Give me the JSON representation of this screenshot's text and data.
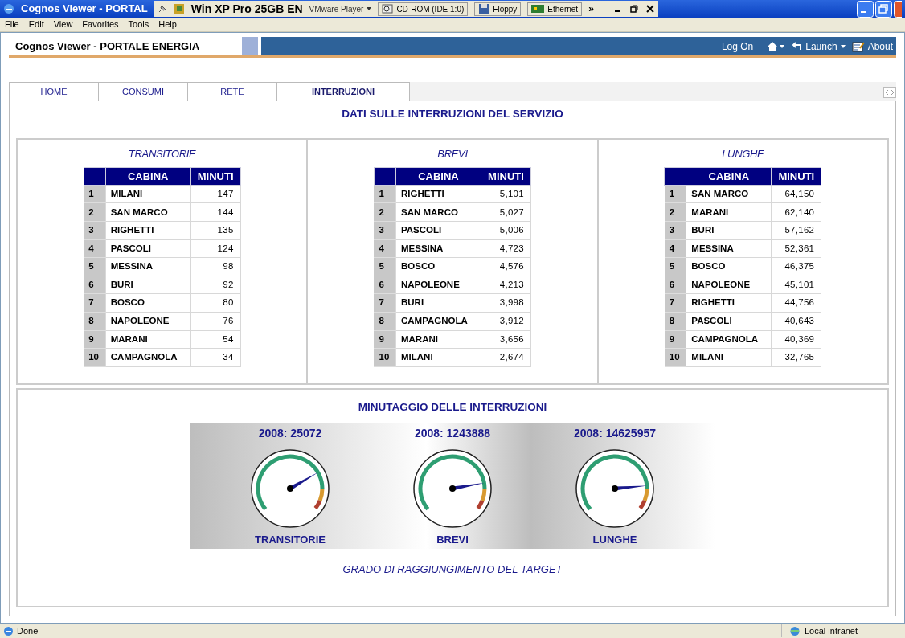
{
  "window": {
    "title": "Cognos Viewer - PORTAL"
  },
  "vm_toolbar": {
    "vm_name": "Win XP Pro 25GB EN",
    "player_menu": "VMware Player",
    "devices": [
      {
        "label": "CD-ROM (IDE 1:0)",
        "kind": "cd"
      },
      {
        "label": "Floppy",
        "kind": "floppy"
      },
      {
        "label": "Ethernet",
        "kind": "network"
      }
    ],
    "more": "»"
  },
  "menu_bar": [
    "File",
    "Edit",
    "View",
    "Favorites",
    "Tools",
    "Help"
  ],
  "header": {
    "title": "Cognos Viewer - PORTALE ENERGIA",
    "links": [
      {
        "label": "Log On",
        "kind": "text"
      },
      {
        "kind": "home"
      },
      {
        "label": "Launch",
        "kind": "launch"
      },
      {
        "label": "About",
        "kind": "about"
      }
    ]
  },
  "tabs": [
    {
      "label": "HOME",
      "selected": false
    },
    {
      "label": "CONSUMI",
      "selected": false
    },
    {
      "label": "RETE",
      "selected": false
    },
    {
      "label": "INTERRUZIONI",
      "selected": true
    }
  ],
  "page_title": "DATI SULLE INTERRUZIONI DEL SERVIZIO",
  "tables": [
    {
      "title": "TRANSITORIE",
      "columns": [
        "",
        "CABINA",
        "MINUTI"
      ],
      "rows": [
        [
          "1",
          "MILANI",
          "147"
        ],
        [
          "2",
          "SAN MARCO",
          "144"
        ],
        [
          "3",
          "RIGHETTI",
          "135"
        ],
        [
          "4",
          "PASCOLI",
          "124"
        ],
        [
          "5",
          "MESSINA",
          "98"
        ],
        [
          "6",
          "BURI",
          "92"
        ],
        [
          "7",
          "BOSCO",
          "80"
        ],
        [
          "8",
          "NAPOLEONE",
          "76"
        ],
        [
          "9",
          "MARANI",
          "54"
        ],
        [
          "10",
          "CAMPAGNOLA",
          "34"
        ]
      ]
    },
    {
      "title": "BREVI",
      "columns": [
        "",
        "CABINA",
        "MINUTI"
      ],
      "rows": [
        [
          "1",
          "RIGHETTI",
          "5,101"
        ],
        [
          "2",
          "SAN MARCO",
          "5,027"
        ],
        [
          "3",
          "PASCOLI",
          "5,006"
        ],
        [
          "4",
          "MESSINA",
          "4,723"
        ],
        [
          "5",
          "BOSCO",
          "4,576"
        ],
        [
          "6",
          "NAPOLEONE",
          "4,213"
        ],
        [
          "7",
          "BURI",
          "3,998"
        ],
        [
          "8",
          "CAMPAGNOLA",
          "3,912"
        ],
        [
          "9",
          "MARANI",
          "3,656"
        ],
        [
          "10",
          "MILANI",
          "2,674"
        ]
      ]
    },
    {
      "title": "LUNGHE",
      "columns": [
        "",
        "CABINA",
        "MINUTI"
      ],
      "rows": [
        [
          "1",
          "SAN MARCO",
          "64,150"
        ],
        [
          "2",
          "MARANI",
          "62,140"
        ],
        [
          "3",
          "BURI",
          "57,162"
        ],
        [
          "4",
          "MESSINA",
          "52,361"
        ],
        [
          "5",
          "BOSCO",
          "46,375"
        ],
        [
          "6",
          "NAPOLEONE",
          "45,101"
        ],
        [
          "7",
          "RIGHETTI",
          "44,756"
        ],
        [
          "8",
          "PASCOLI",
          "40,643"
        ],
        [
          "9",
          "CAMPAGNOLA",
          "40,369"
        ],
        [
          "10",
          "MILANI",
          "32,765"
        ]
      ]
    }
  ],
  "gauges_section": {
    "title": "MINUTAGGIO DELLE INTERRUZIONI",
    "gauges": [
      {
        "value": "2008: 25072",
        "label": "TRANSITORIE"
      },
      {
        "value": "2008: 1243888",
        "label": "BREVI"
      },
      {
        "value": "2008: 14625957",
        "label": "LUNGHE"
      }
    ],
    "caption": "GRADO DI RAGGIUNGIMENTO DEL TARGET"
  },
  "status_bar": {
    "status": "Done",
    "zone": "Local intranet"
  }
}
